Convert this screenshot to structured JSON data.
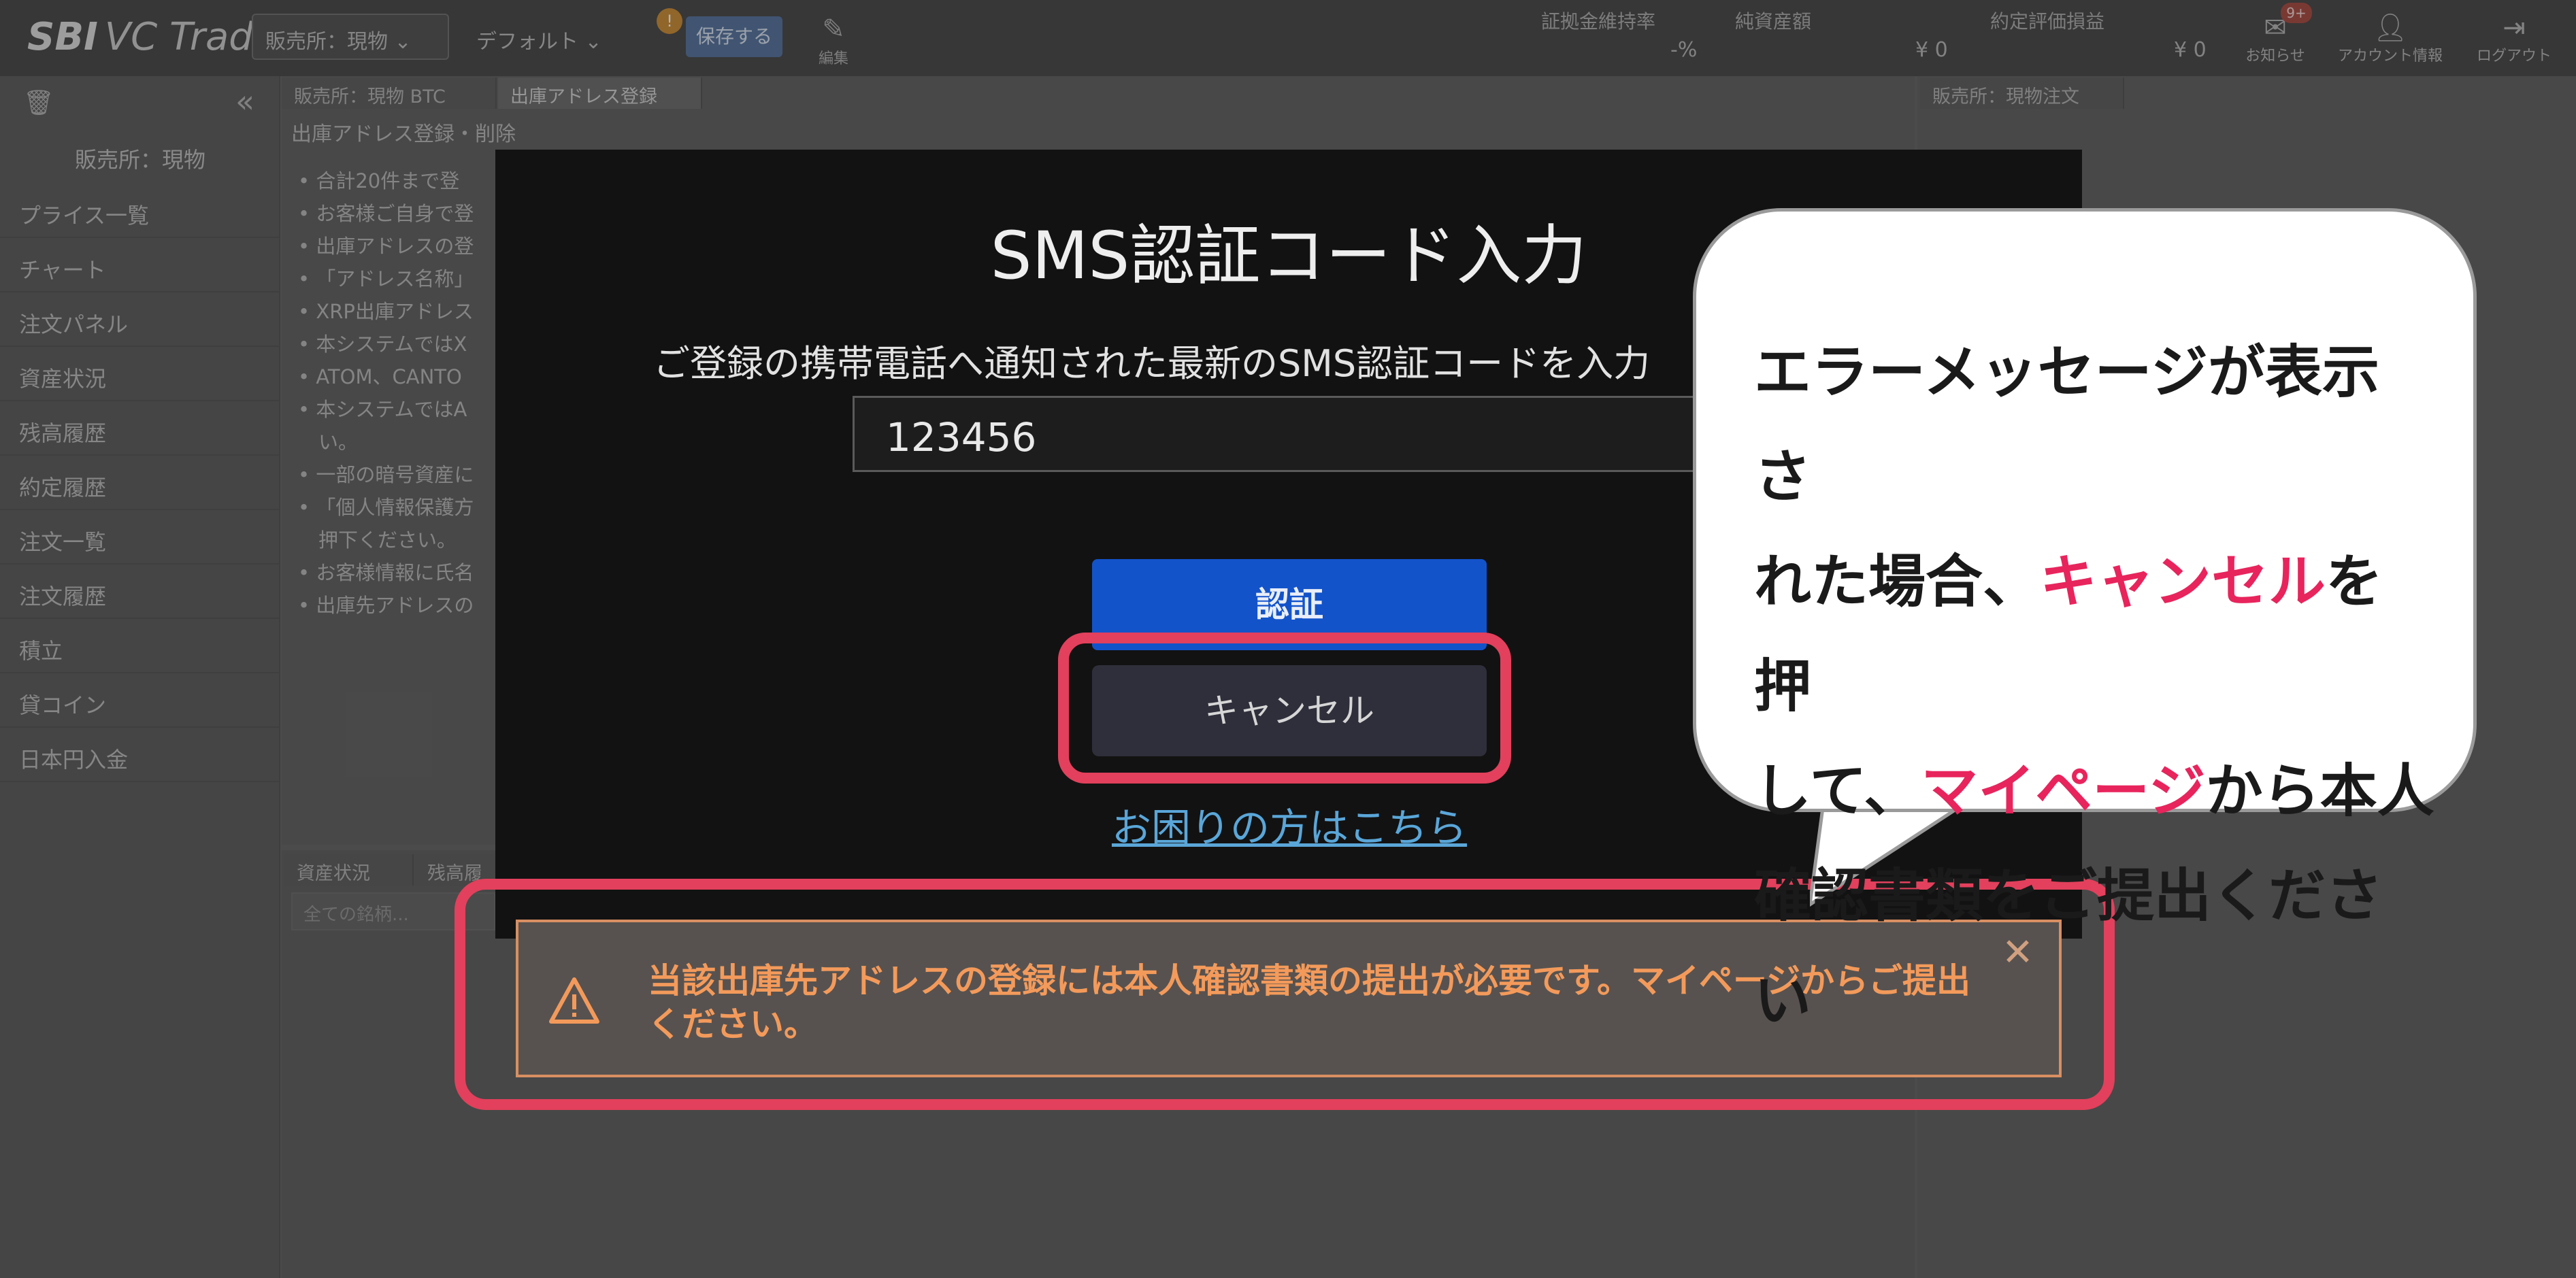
{
  "app": {
    "logo_brand": "SBI",
    "logo_name": "VC Trade",
    "market_select": "販売所：現物",
    "layout_select": "デフォルト",
    "save_badge": "!",
    "save_label": "保存する",
    "edit_label": "編集"
  },
  "stats": [
    {
      "label": "証拠金維持率",
      "value": "-%"
    },
    {
      "label": "純資産額",
      "value": "¥ 0"
    },
    {
      "label": "約定評価損益",
      "value": "¥ 0"
    }
  ],
  "top_icons": {
    "notifications_label": "お知らせ",
    "notifications_badge": "9+",
    "account_label": "アカウント情報",
    "logout_label": "ログアウト"
  },
  "sidebar": {
    "collapse_glyph": "«",
    "title": "販売所：現物",
    "items": [
      "プライス一覧",
      "チャート",
      "注文パネル",
      "資産状況",
      "残高履歴",
      "約定履歴",
      "注文一覧",
      "注文履歴",
      "積立",
      "貸コイン",
      "日本円入金"
    ]
  },
  "tabs": {
    "left_tab": "販売所：現物 BTC",
    "active_tab": "出庫アドレス登録",
    "right_tab": "販売所：現物注文",
    "bottom_tab1": "資産状況",
    "bottom_tab2": "残高履"
  },
  "address_panel": {
    "heading": "出庫アドレス登録・削除",
    "bullets": [
      "合計20件まで登",
      "お客様ご自身で登",
      "出庫アドレスの登",
      "「アドレス名称」",
      "XRP出庫アドレス",
      "本システムではX",
      "ATOM、CANTO",
      "本システムではA",
      "一部の暗号資産に",
      "「個人情報保護方",
      "お客様情報に氏名",
      "出庫先アドレスの"
    ],
    "bullet_cont_1": "い。",
    "bullet_cont_2": "押下ください。",
    "filter_placeholder": "全ての銘柄..."
  },
  "modal": {
    "title": "SMS認証コード入力",
    "description": "ご登録の携帯電話へ通知された最新のSMS認証コードを入力",
    "code_value": "123456",
    "auth_button": "認証",
    "cancel_button": "キャンセル",
    "help_link": "お困りの方はこちら"
  },
  "error": {
    "message": "当該出庫先アドレスの登録には本人確認書類の提出が必要です。マイページからご提出ください。",
    "close_glyph": "✕"
  },
  "bubble": {
    "line1": "エラーメッセージが表示さ",
    "line2_pre": "れた場合、",
    "line2_em": "キャンセル",
    "line2_post": "を押",
    "line3_pre": "して、",
    "line3_em": "マイページ",
    "line3_post": "から本人",
    "line4": "確認書類をご提出ください"
  },
  "colors": {
    "highlight": "#e2405c",
    "accent_pink": "#e8245c",
    "auth_blue": "#1353c9",
    "error_text": "#f39a5b"
  }
}
